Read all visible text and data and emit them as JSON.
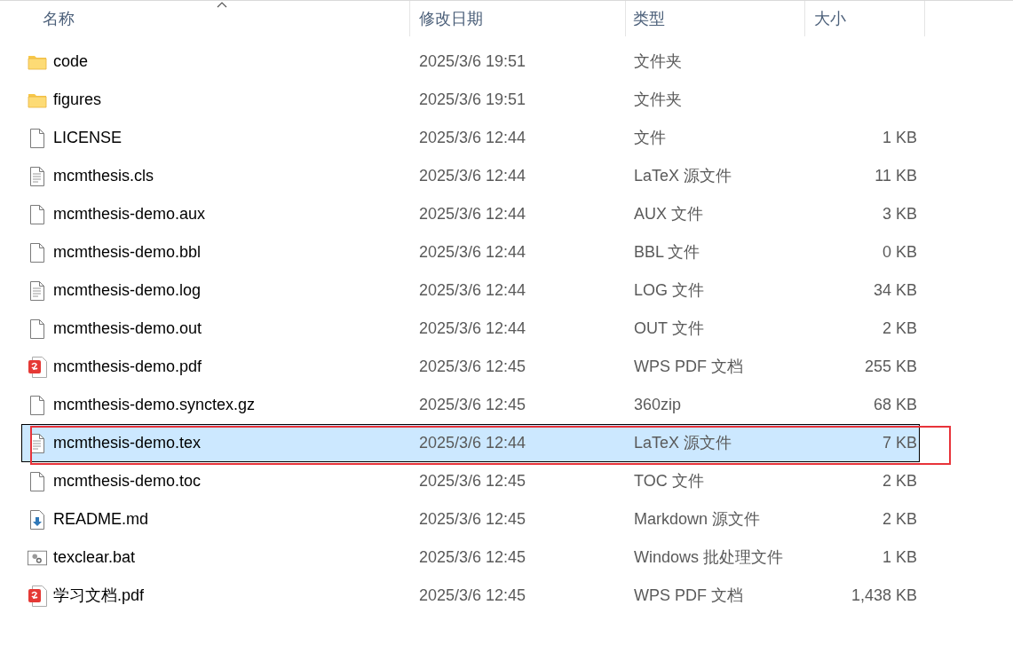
{
  "columns": [
    {
      "label": "名称",
      "sorted": true
    },
    {
      "label": "修改日期",
      "sorted": false
    },
    {
      "label": "类型",
      "sorted": false
    },
    {
      "label": "大小",
      "sorted": false
    }
  ],
  "rows": [
    {
      "kind": "folder",
      "name": "code",
      "date": "2025/3/6 19:51",
      "type": "文件夹",
      "selected": false,
      "annotated": false
    },
    {
      "kind": "folder",
      "name": "figures",
      "date": "2025/3/6 19:51",
      "type": "文件夹",
      "selected": false,
      "annotated": false
    },
    {
      "kind": "blank",
      "name": "LICENSE",
      "date": "2025/3/6 12:44",
      "type": "文件",
      "size": "1 KB",
      "selected": false,
      "annotated": false
    },
    {
      "kind": "text",
      "name": "mcmthesis.cls",
      "date": "2025/3/6 12:44",
      "type": "LaTeX 源文件",
      "size": "11 KB",
      "selected": false,
      "annotated": false
    },
    {
      "kind": "blank",
      "name": "mcmthesis-demo.aux",
      "date": "2025/3/6 12:44",
      "type": "AUX 文件",
      "size": "3 KB",
      "selected": false,
      "annotated": false
    },
    {
      "kind": "blank",
      "name": "mcmthesis-demo.bbl",
      "date": "2025/3/6 12:44",
      "type": "BBL 文件",
      "size": "0 KB",
      "selected": false,
      "annotated": false
    },
    {
      "kind": "text",
      "name": "mcmthesis-demo.log",
      "date": "2025/3/6 12:44",
      "type": "LOG 文件",
      "size": "34 KB",
      "selected": false,
      "annotated": false
    },
    {
      "kind": "blank",
      "name": "mcmthesis-demo.out",
      "date": "2025/3/6 12:44",
      "type": "OUT 文件",
      "size": "2 KB",
      "selected": false,
      "annotated": false
    },
    {
      "kind": "pdf",
      "name": "mcmthesis-demo.pdf",
      "date": "2025/3/6 12:45",
      "type": "WPS PDF 文档",
      "size": "255 KB",
      "selected": false,
      "annotated": false
    },
    {
      "kind": "blank",
      "name": "mcmthesis-demo.synctex.gz",
      "date": "2025/3/6 12:45",
      "type": "360zip",
      "size": "68 KB",
      "selected": false,
      "annotated": false
    },
    {
      "kind": "text",
      "name": "mcmthesis-demo.tex",
      "date": "2025/3/6 12:44",
      "type": "LaTeX 源文件",
      "size": "7 KB",
      "selected": true,
      "annotated": true
    },
    {
      "kind": "blank",
      "name": "mcmthesis-demo.toc",
      "date": "2025/3/6 12:45",
      "type": "TOC 文件",
      "size": "2 KB",
      "selected": false,
      "annotated": false
    },
    {
      "kind": "markdown",
      "name": "README.md",
      "date": "2025/3/6 12:45",
      "type": "Markdown 源文件",
      "size": "2 KB",
      "selected": false,
      "annotated": false
    },
    {
      "kind": "batch",
      "name": "texclear.bat",
      "date": "2025/3/6 12:45",
      "type": "Windows 批处理文件",
      "size": "1 KB",
      "selected": false,
      "annotated": false
    },
    {
      "kind": "pdf",
      "name": "学习文档.pdf",
      "date": "2025/3/6 12:45",
      "type": "WPS PDF 文档",
      "size": "1,438 KB",
      "selected": false,
      "annotated": false
    }
  ]
}
